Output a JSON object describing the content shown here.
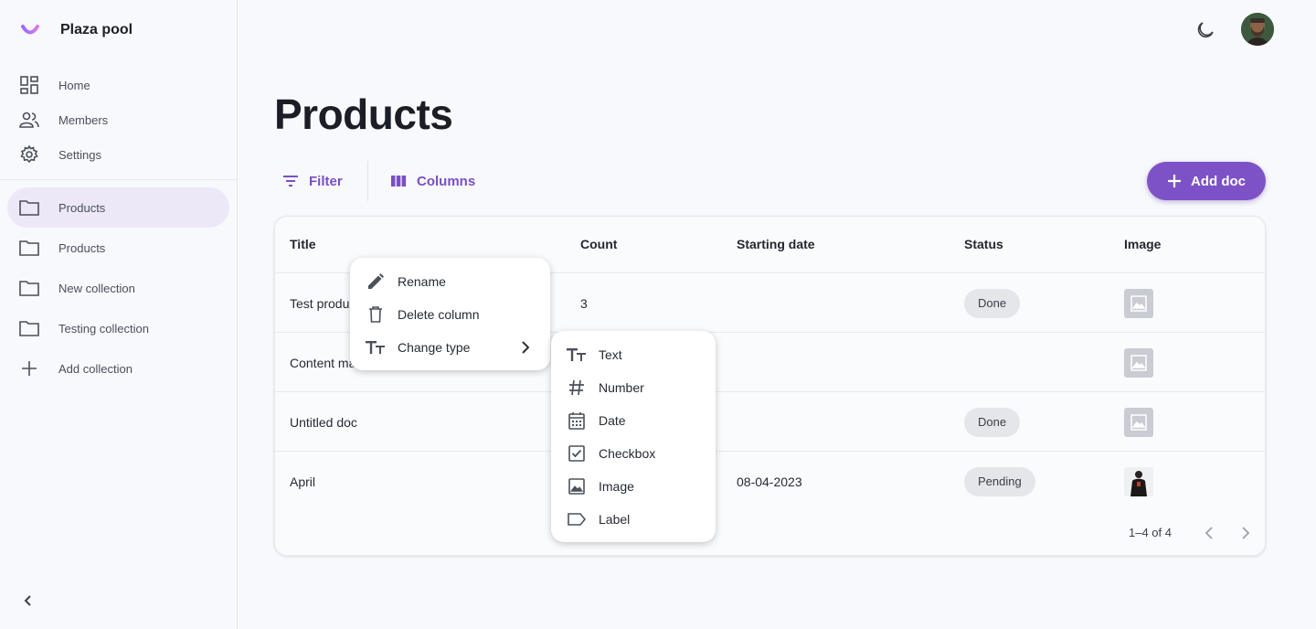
{
  "app": {
    "name": "Plaza pool"
  },
  "sidebar": {
    "nav": [
      {
        "label": "Home",
        "icon": "dashboard-icon"
      },
      {
        "label": "Members",
        "icon": "people-icon"
      },
      {
        "label": "Settings",
        "icon": "gear-icon"
      }
    ],
    "collections": [
      {
        "label": "Products",
        "icon": "folder-icon",
        "active": true
      },
      {
        "label": "Products",
        "icon": "folder-icon"
      },
      {
        "label": "New collection",
        "icon": "folder-icon"
      },
      {
        "label": "Testing collection",
        "icon": "folder-icon"
      }
    ],
    "add_collection": "Add collection"
  },
  "page": {
    "title": "Products"
  },
  "toolbar": {
    "filter": "Filter",
    "columns": "Columns",
    "add_doc": "Add doc"
  },
  "table": {
    "headers": [
      "Title",
      "Count",
      "Starting date",
      "Status",
      "Image"
    ],
    "rows": [
      {
        "title": "Test produ",
        "count": "3",
        "date": "",
        "status": "Done",
        "image": "placeholder"
      },
      {
        "title": "Content ma",
        "count": "",
        "date": "",
        "status": "",
        "image": "placeholder"
      },
      {
        "title": "Untitled doc",
        "count": "",
        "date": "",
        "status": "Done",
        "image": "placeholder"
      },
      {
        "title": "April",
        "count": "",
        "date": "08-04-2023",
        "status": "Pending",
        "image": "photo"
      }
    ],
    "pagination": "1–4 of 4"
  },
  "column_menu": {
    "items": [
      "Rename",
      "Delete column",
      "Change type"
    ]
  },
  "type_menu": {
    "items": [
      "Text",
      "Number",
      "Date",
      "Checkbox",
      "Image",
      "Label"
    ]
  },
  "colors": {
    "accent": "#7d52c6",
    "active_bg": "#ece8f8",
    "badge_bg": "#e4e6ea"
  }
}
